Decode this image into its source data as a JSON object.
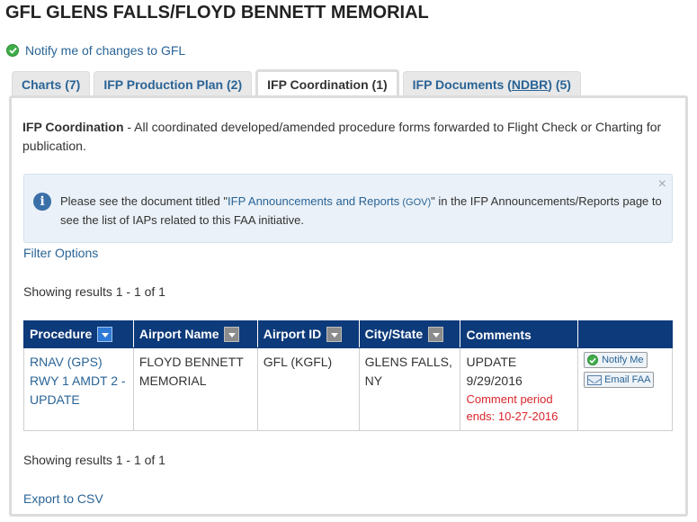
{
  "page": {
    "title": "GFL GLENS FALLS/FLOYD BENNETT MEMORIAL",
    "notify_label": "Notify me of changes to GFL"
  },
  "tabs": [
    {
      "label": "Charts (7)",
      "active": false
    },
    {
      "label": "IFP Production Plan (2)",
      "active": false
    },
    {
      "label": "IFP Coordination (1)",
      "active": true
    },
    {
      "label_prefix": "IFP Documents (",
      "label_underlined": "NDBR",
      "label_suffix": ") (5)",
      "active": false
    }
  ],
  "coordination": {
    "heading": "IFP Coordination",
    "description": " - All coordinated developed/amended procedure forms forwarded to Flight Check or Charting for publication."
  },
  "alert": {
    "text_before": "Please see the document titled \"",
    "link_text": "IFP Announcements and Reports",
    "gov_tag": " (GOV)",
    "text_after": "\" in the IFP Announcements/Reports page to see the list of IAPs related to this FAA initiative.",
    "close_glyph": "×",
    "info_glyph": "i"
  },
  "filter_options_label": "Filter Options",
  "results_top": "Showing results 1 - 1 of 1",
  "results_bottom": "Showing results 1 - 1 of 1",
  "table": {
    "headers": [
      "Procedure",
      "Airport Name",
      "Airport ID",
      "City/State",
      "Comments",
      ""
    ],
    "rows": [
      {
        "procedure": "RNAV (GPS) RWY 1 AMDT 2 - UPDATE",
        "airport_name": "FLOYD BENNETT MEMORIAL",
        "airport_id": "GFL (KGFL)",
        "city_state": "GLENS FALLS, NY",
        "comment_type": "UPDATE",
        "comment_date": "9/29/2016",
        "comment_period": "Comment period ends: 10-27-2016",
        "notify_label": "Notify Me",
        "email_label": "Email FAA"
      }
    ]
  },
  "export_label": "Export to CSV",
  "colors": {
    "header_bg": "#0d3a7a",
    "link": "#2a6496",
    "alert_red": "#d9262b",
    "success_green": "#3fae49"
  }
}
